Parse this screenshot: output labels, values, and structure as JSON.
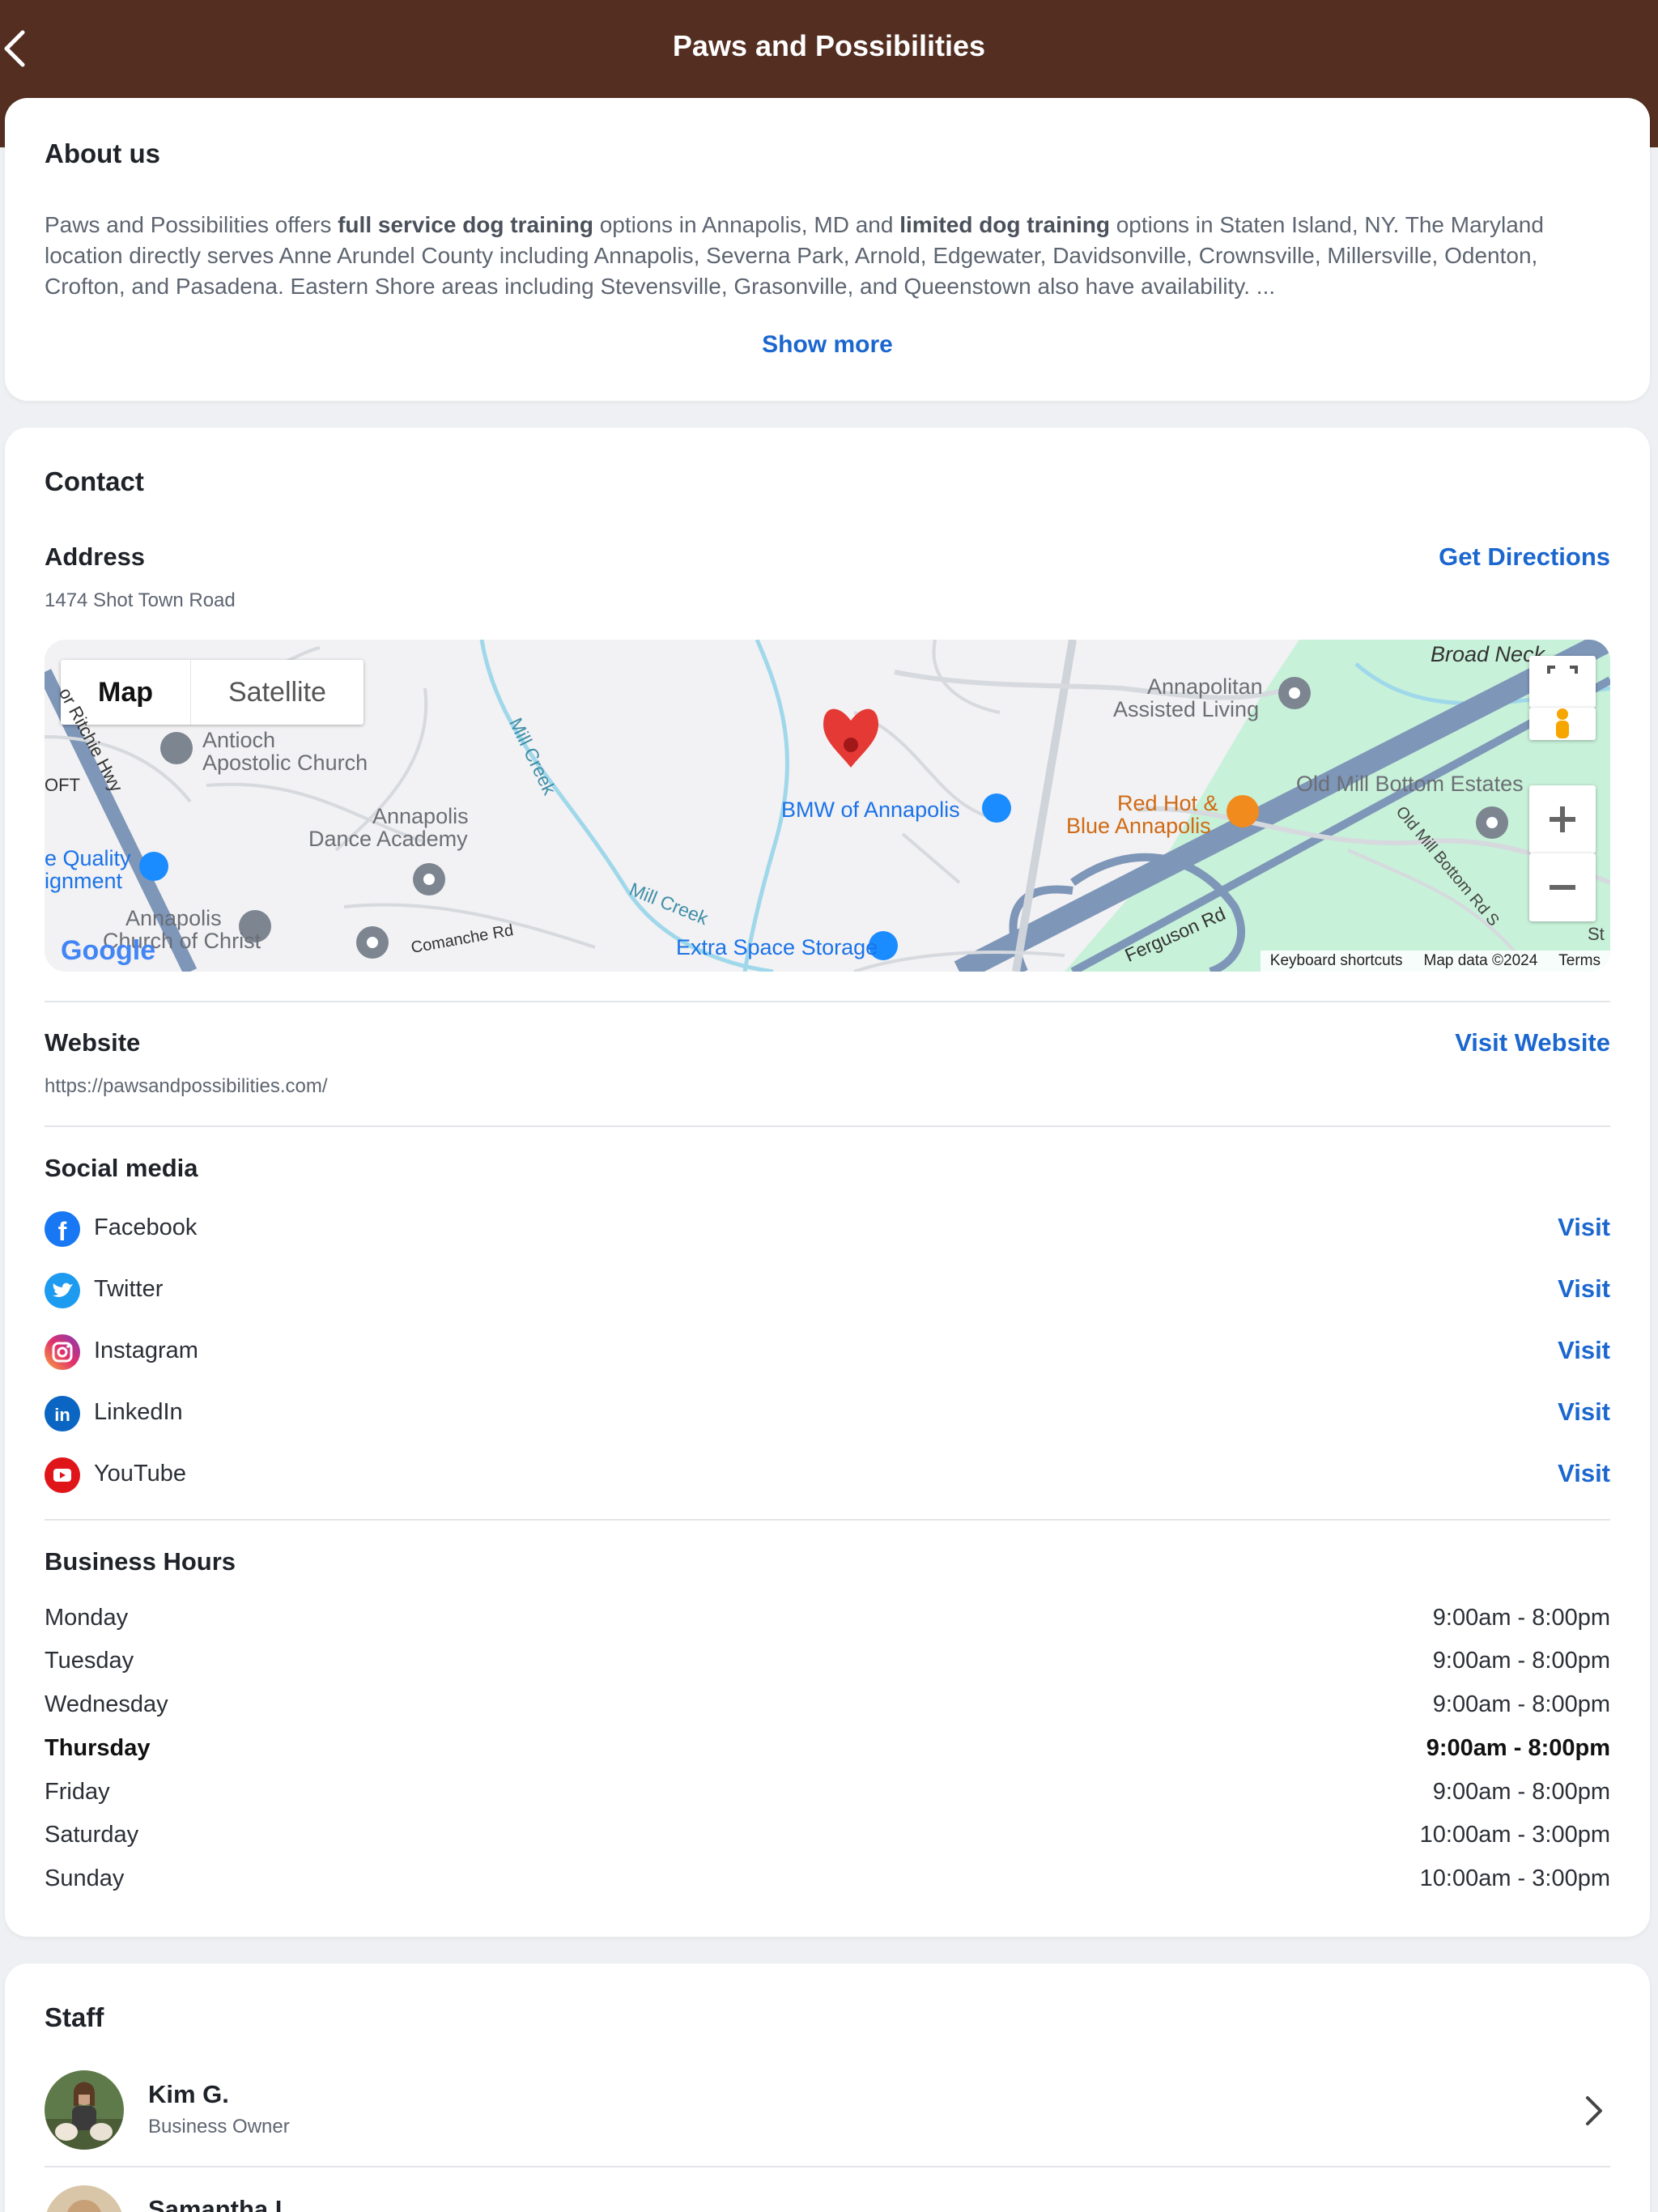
{
  "header": {
    "title": "Paws and Possibilities"
  },
  "about": {
    "heading": "About us",
    "text_1": "Paws and Possibilities offers ",
    "bold_1": "full service dog training",
    "text_2": " options in Annapolis, MD and ",
    "bold_2": "limited dog training",
    "text_3": " options in Staten Island, NY. The Maryland location directly serves Anne Arundel County including Annapolis, Severna Park, Arnold, Edgewater, Davidsonville, Crownsville, Millersville, Odenton, Crofton, and Pasadena. Eastern Shore areas including Stevensville, Grasonville, and Queenstown also have availability. ...",
    "show_more": "Show more"
  },
  "contact": {
    "heading": "Contact",
    "address_label": "Address",
    "address_value": "1474 Shot Town Road",
    "directions_link": "Get Directions",
    "website_label": "Website",
    "website_value": "https://pawsandpossibilities.com/",
    "website_link": "Visit Website",
    "map": {
      "toggle_map": "Map",
      "toggle_satellite": "Satellite",
      "labels": {
        "broad_neck": "Broad Neck",
        "annapolitan": "Annapolitan",
        "assisted_living": "Assisted Living",
        "antioch_1": "Antioch",
        "antioch_2": "Apostolic Church",
        "ritchie_hwy": "or Ritchie Hwy",
        "oft": "OFT",
        "mill_creek_1": "Mill Creek",
        "mill_creek_2": "Mill Creek",
        "bmw": "BMW of Annapolis",
        "red_hot_1": "Red Hot &",
        "red_hot_2": "Blue Annapolis",
        "old_mill_estates": "Old Mill Bottom Estates",
        "old_mill_rd": "Old Mill Bottom Rd S",
        "st": "St",
        "annapolis_dance_1": "Annapolis",
        "annapolis_dance_2": "Dance Academy",
        "quality_1": "e Quality",
        "quality_2": "ignment",
        "annapolis_church_1": "Annapolis",
        "annapolis_church_2": "Church of Christ",
        "comanche": "Comanche Rd",
        "extra_space": "Extra Space Storage",
        "ferguson": "Ferguson Rd",
        "google": "Google"
      },
      "footer_shortcuts": "Keyboard shortcuts",
      "footer_data": "Map data ©2024",
      "footer_terms": "Terms"
    }
  },
  "social": {
    "heading": "Social media",
    "visit_label": "Visit",
    "items": [
      {
        "name": "Facebook",
        "icon": "facebook-icon",
        "color": "#1877f2"
      },
      {
        "name": "Twitter",
        "icon": "twitter-icon",
        "color": "#1d9bf0"
      },
      {
        "name": "Instagram",
        "icon": "instagram-icon",
        "color": "#d6249f"
      },
      {
        "name": "LinkedIn",
        "icon": "linkedin-icon",
        "color": "#0a66c2"
      },
      {
        "name": "YouTube",
        "icon": "youtube-icon",
        "color": "#e0151a"
      }
    ]
  },
  "hours": {
    "heading": "Business Hours",
    "days": [
      {
        "day": "Monday",
        "time": "9:00am - 8:00pm"
      },
      {
        "day": "Tuesday",
        "time": "9:00am - 8:00pm"
      },
      {
        "day": "Wednesday",
        "time": "9:00am - 8:00pm"
      },
      {
        "day": "Thursday",
        "time": "9:00am - 8:00pm"
      },
      {
        "day": "Friday",
        "time": "9:00am - 8:00pm"
      },
      {
        "day": "Saturday",
        "time": "10:00am - 3:00pm"
      },
      {
        "day": "Sunday",
        "time": "10:00am - 3:00pm"
      }
    ]
  },
  "staff": {
    "heading": "Staff",
    "members": [
      {
        "name": "Kim G.",
        "role": "Business Owner"
      },
      {
        "name": "Samantha L."
      }
    ]
  },
  "colors": {
    "header_bg": "#532e21",
    "link": "#1b67cf",
    "map_pin": "#e53935",
    "park_green": "#c8f1d9"
  }
}
